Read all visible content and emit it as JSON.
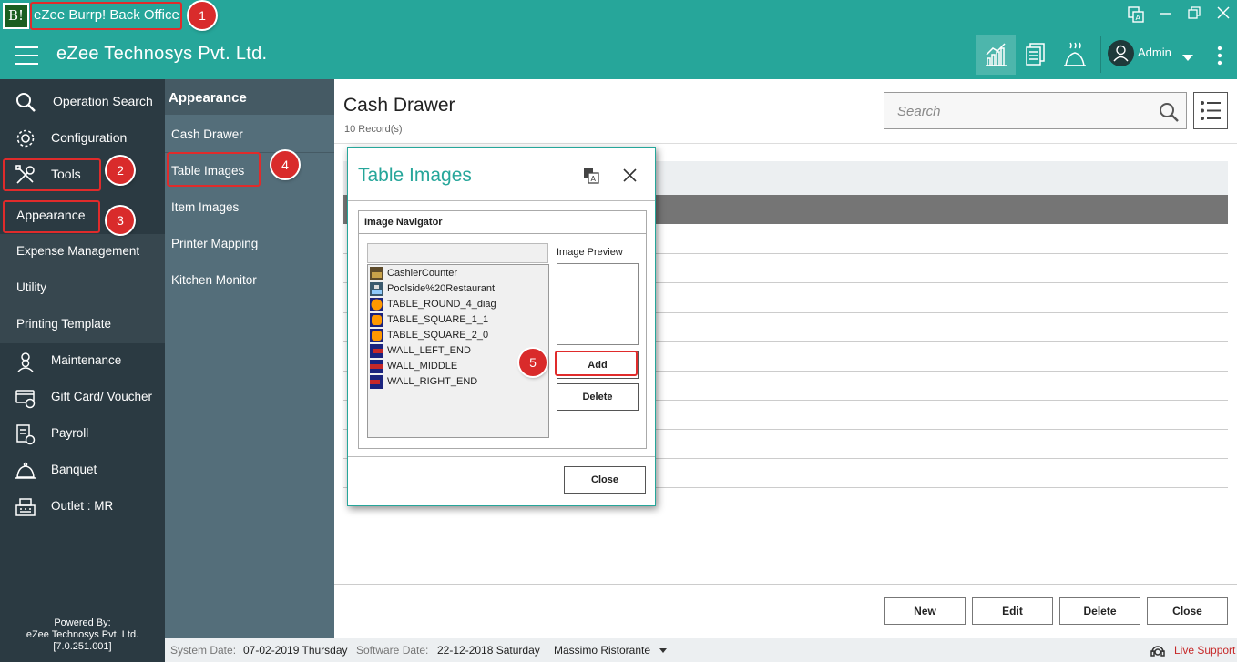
{
  "window": {
    "logo": "B!",
    "title": "eZee Burrp! Back Office"
  },
  "header": {
    "company": "eZee Technosys Pvt. Ltd.",
    "user": "Admin"
  },
  "sidebar": {
    "items": [
      {
        "label": "Operation Search",
        "icon": "search-icon"
      },
      {
        "label": "Configuration",
        "icon": "gear-icon"
      },
      {
        "label": "Tools",
        "icon": "tools-icon"
      },
      {
        "label": "Appearance"
      },
      {
        "label": "Expense Management"
      },
      {
        "label": "Utility"
      },
      {
        "label": "Printing Template"
      },
      {
        "label": "Maintenance",
        "icon": "chef-icon"
      },
      {
        "label": "Gift Card/ Voucher",
        "icon": "gift-card-icon"
      },
      {
        "label": "Payroll",
        "icon": "payroll-icon"
      },
      {
        "label": "Banquet",
        "icon": "banquet-icon"
      },
      {
        "label": "Outlet : MR",
        "icon": "cash-register-icon"
      }
    ],
    "powered_line1": "Powered By:",
    "powered_line2": "eZee Technosys Pvt. Ltd.",
    "powered_line3": "[7.0.251.001]"
  },
  "submenu": {
    "title": "Appearance",
    "items": [
      "Cash Drawer",
      "Table Images",
      "Item Images",
      "Printer Mapping",
      "Kitchen Monitor"
    ]
  },
  "main": {
    "title": "Cash Drawer",
    "records": "10 Record(s)",
    "search_placeholder": "Search",
    "buttons": {
      "new": "New",
      "edit": "Edit",
      "delete": "Delete",
      "close": "Close"
    }
  },
  "dialog": {
    "title": "Table Images",
    "group_title": "Image Navigator",
    "preview_label": "Image Preview",
    "images": [
      "CashierCounter",
      "Poolside%20Restaurant",
      "TABLE_ROUND_4_diag",
      "TABLE_SQUARE_1_1",
      "TABLE_SQUARE_2_0",
      "WALL_LEFT_END",
      "WALL_MIDDLE",
      "WALL_RIGHT_END"
    ],
    "add": "Add",
    "delete": "Delete",
    "close": "Close"
  },
  "status": {
    "system_date_label": "System Date:",
    "system_date": "07-02-2019 Thursday",
    "software_date_label": "Software Date:",
    "software_date": "22-12-2018 Saturday",
    "outlet": "Massimo Ristorante",
    "live_support": "Live Support"
  },
  "annotations": [
    "1",
    "2",
    "3",
    "4",
    "5"
  ],
  "colors": {
    "accent": "#26a69a",
    "sidebar": "#2b3a42",
    "panel": "#546e7a",
    "marker": "#d92b2b"
  }
}
